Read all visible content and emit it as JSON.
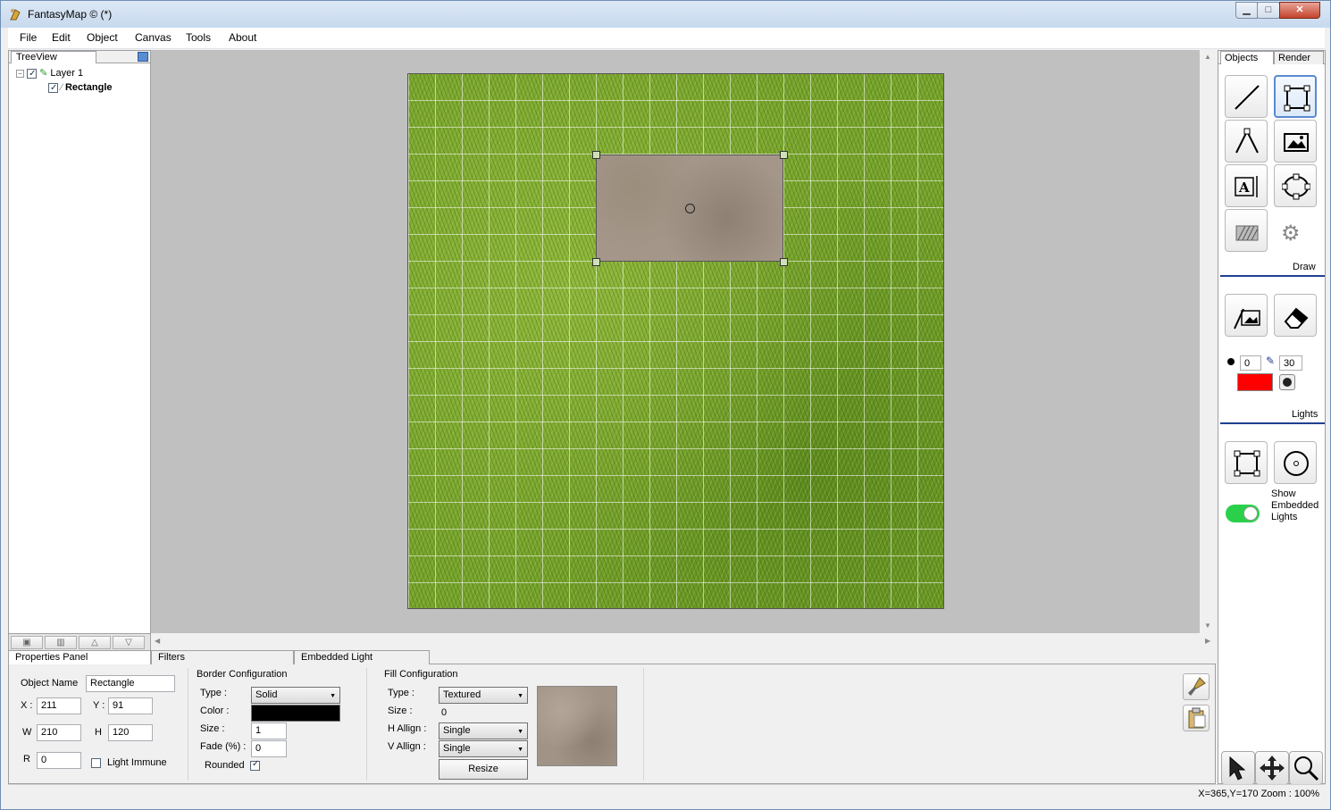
{
  "window": {
    "title": "FantasyMap © (*)"
  },
  "menu": [
    "File",
    "Edit",
    "Object",
    "Canvas",
    "Tools",
    "About"
  ],
  "tree": {
    "tab": "TreeView",
    "nodes": [
      {
        "label": "Layer 1",
        "checked": true
      },
      {
        "label": "Rectangle",
        "checked": true
      }
    ]
  },
  "right_panel": {
    "tabs": [
      "Objects",
      "Render"
    ],
    "draw_label": "Draw",
    "lights_label": "Lights",
    "brush_opacity": "0",
    "brush_size": "30",
    "brush_color": "#ff0000",
    "show_embedded_lights_label": "Show Embedded Lights",
    "show_embedded_lights_on": true,
    "toggle_color": "#2bd04a"
  },
  "bottom_tabs": [
    "Properties Panel",
    "Filters",
    "Embedded Light"
  ],
  "properties": {
    "object_name_label": "Object Name",
    "object_name": "Rectangle",
    "x_label": "X :",
    "x": "211",
    "y_label": "Y :",
    "y": "91",
    "w_label": "W",
    "w": "210",
    "h_label": "H",
    "h": "120",
    "r_label": "R",
    "r": "0",
    "light_immune_label": "Light Immune",
    "light_immune": false
  },
  "border": {
    "title": "Border Configuration",
    "type_label": "Type :",
    "type": "Solid",
    "color_label": "Color :",
    "color": "#000000",
    "size_label": "Size :",
    "size": "1",
    "fade_label": "Fade (%) :",
    "fade": "0",
    "rounded_label": "Rounded",
    "rounded": true
  },
  "fill": {
    "title": "Fill Configuration",
    "type_label": "Type :",
    "type": "Textured",
    "size_label": "Size :",
    "size": "0",
    "h_align_label": "H Allign :",
    "h_align": "Single",
    "v_align_label": "V Allign :",
    "v_align": "Single",
    "resize_label": "Resize"
  },
  "status": {
    "text": "X=365,Y=170  Zoom : 100%"
  }
}
